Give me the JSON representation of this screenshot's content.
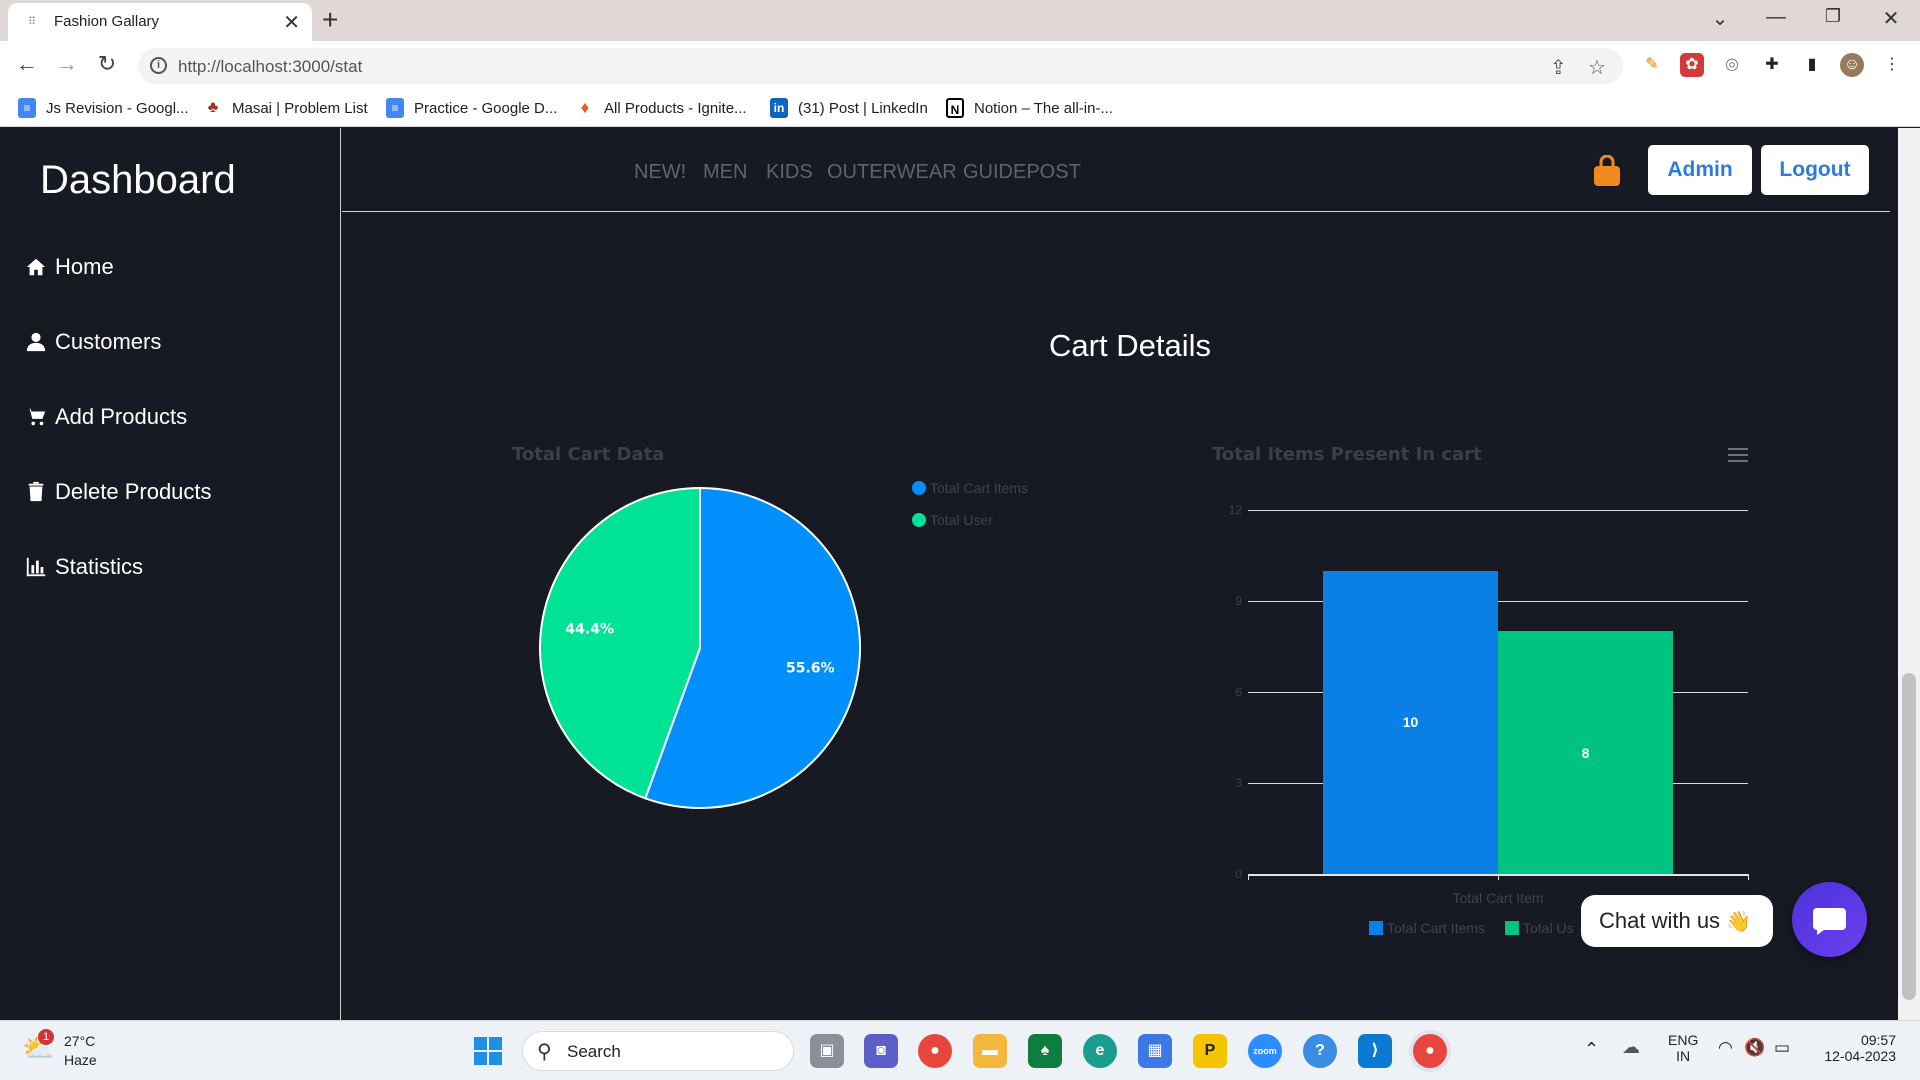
{
  "browser": {
    "tab_title": "Fashion Gallary",
    "url": "http://localhost:3000/stat",
    "bookmarks": [
      "Js Revision - Googl...",
      "Masai | Problem List",
      "Practice - Google D...",
      "All Products - Ignite...",
      "(31) Post | LinkedIn",
      "Notion – The all-in-..."
    ]
  },
  "sidebar": {
    "title": "Dashboard",
    "items": [
      {
        "label": "Home",
        "icon": "home-icon"
      },
      {
        "label": "Customers",
        "icon": "user-icon"
      },
      {
        "label": "Add Products",
        "icon": "cart-icon"
      },
      {
        "label": "Delete Products",
        "icon": "trash-icon"
      },
      {
        "label": "Statistics",
        "icon": "bar-chart-icon"
      }
    ]
  },
  "topnav": {
    "links": [
      "NEW!",
      "MEN",
      "KIDS",
      "OUTERWEAR",
      "GUIDEPOST"
    ],
    "admin_label": "Admin",
    "logout_label": "Logout"
  },
  "page": {
    "heading": "Cart Details"
  },
  "chart_data": [
    {
      "type": "pie",
      "title": "Total Cart Data",
      "slices": [
        {
          "name": "Total Cart Items",
          "value": 10,
          "percent_label": "55.6%",
          "color": "#008ffb"
        },
        {
          "name": "Total User",
          "value": 8,
          "percent_label": "44.4%",
          "color": "#00e396"
        }
      ],
      "legend_position": "top-right"
    },
    {
      "type": "bar",
      "title": "Total Items Present In cart",
      "categories": [
        "Total Cart Item"
      ],
      "series": [
        {
          "name": "Total Cart Items",
          "values": [
            10
          ],
          "color": "#0a7fe6"
        },
        {
          "name": "Total User",
          "values": [
            8
          ],
          "color": "#00c281"
        }
      ],
      "yticks": [
        "0",
        "3",
        "6",
        "9",
        "12"
      ],
      "ylim": [
        0,
        12
      ],
      "grid": true,
      "legend_position": "bottom",
      "legend_labels_visible": [
        "Total Cart Items",
        "Total Us"
      ]
    }
  ],
  "chat": {
    "label": "Chat with us"
  },
  "taskbar": {
    "weather_temp": "27°C",
    "weather_desc": "Haze",
    "weather_badge": "1",
    "search_label": "Search",
    "lang_line1": "ENG",
    "lang_line2": "IN",
    "time": "09:57",
    "date": "12-04-2023"
  }
}
